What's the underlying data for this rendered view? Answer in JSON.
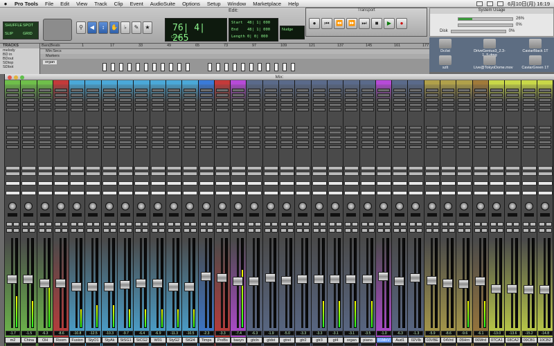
{
  "menubar": {
    "app": "Pro Tools",
    "items": [
      "File",
      "Edit",
      "View",
      "Track",
      "Clip",
      "Event",
      "AudioSuite",
      "Options",
      "Setup",
      "Window",
      "Marketplace",
      "Help"
    ],
    "clock": "6月10日(月)  16:19"
  },
  "edit": {
    "title": "Edit: ",
    "mode_labels": [
      "SHUFFLE",
      "SPOT",
      "SLIP",
      "GRID"
    ],
    "counter_main": "76| 4| 265",
    "counter_label": "Cursor",
    "selection": [
      {
        "label": "Start",
        "value": "48| 1| 000"
      },
      {
        "label": "End",
        "value": "48| 1| 000"
      },
      {
        "label": "Length",
        "value": "0| 0| 000"
      }
    ],
    "nudge_label": "Nudge"
  },
  "transport": {
    "title": "Transport"
  },
  "sysusage": {
    "title": "System Usage",
    "rows": [
      {
        "label": "",
        "value": "26%",
        "fill": 0.26
      },
      {
        "label": "",
        "value": "0%",
        "fill": 0.0
      },
      {
        "label": "Disk",
        "value": "0%",
        "fill": 0.0
      }
    ]
  },
  "desktop": [
    "Dc/ist",
    "DriveGenius3_2.3-1_5.dmg",
    "CaviarBlack 1T",
    "szlt",
    "Live@TokyoDome.mov",
    "CaviarGreen 1T"
  ],
  "tracks": {
    "header": "TRACKS",
    "names": [
      "melody",
      "BD in",
      "BDout",
      "SDtop",
      "SDbot"
    ],
    "ruler_label": "Bars|Beats",
    "ruler_marks": [
      "1",
      "17",
      "33",
      "49",
      "65",
      "73",
      "97",
      "109",
      "121",
      "137",
      "145",
      "161",
      "177"
    ],
    "min_secs": "Min:Secs",
    "markers": "Markers",
    "clip_name": "organ"
  },
  "mix": {
    "title": "Mix: ",
    "strips": [
      {
        "name": "m2",
        "color": "#6fbf4a",
        "vol": "-1.7",
        "foot": "3166",
        "level": 0.35,
        "fader": 0.55
      },
      {
        "name": "China",
        "color": "#6fbf4a",
        "vol": "-1.5",
        "foot": "3166",
        "level": 0.3,
        "fader": 0.55
      },
      {
        "name": "OH",
        "color": "#6fbf4a",
        "vol": "-6.3",
        "foot": "3166",
        "level": 0.55,
        "fader": 0.5
      },
      {
        "name": "Room",
        "color": "#c43a3a",
        "vol": "-8.6",
        "foot": "3169",
        "level": 0.0,
        "fader": 0.5
      },
      {
        "name": "Fusion",
        "color": "#4aa8d8",
        "vol": "-10.8",
        "foot": "3166",
        "level": 0.2,
        "fader": 0.45
      },
      {
        "name": "StyO1",
        "color": "#4aa8d8",
        "vol": "-12.5",
        "foot": "3166",
        "level": 0.25,
        "fader": 0.45
      },
      {
        "name": "StyAk",
        "color": "#4aa8d8",
        "vol": "-10.3",
        "foot": "3166",
        "level": 0.25,
        "fader": 0.45
      },
      {
        "name": "StSG1",
        "color": "#4aa8d8",
        "vol": "-9.7",
        "foot": "3166",
        "level": 0.2,
        "fader": 0.48
      },
      {
        "name": "StCG2",
        "color": "#4aa8d8",
        "vol": "-6.4",
        "foot": "3166",
        "level": 0.2,
        "fader": 0.5
      },
      {
        "name": "W01",
        "color": "#4aa8d8",
        "vol": "-6.9",
        "foot": "3166",
        "level": 0.2,
        "fader": 0.5
      },
      {
        "name": "StyG2",
        "color": "#4aa8d8",
        "vol": "-11.3",
        "foot": "3166",
        "level": 0.2,
        "fader": 0.45
      },
      {
        "name": "StGl4",
        "color": "#4aa8d8",
        "vol": "-10.5",
        "foot": "3166",
        "level": 0.2,
        "fader": 0.45
      },
      {
        "name": "Timps",
        "color": "#3a7ad8",
        "vol": "-2.3",
        "foot": "3166",
        "level": 0.0,
        "fader": 0.58
      },
      {
        "name": "ProBs",
        "color": "#c43a3a",
        "vol": "-3.3",
        "foot": "3166",
        "level": 0.0,
        "fader": 0.56
      },
      {
        "name": "basyn",
        "color": "#b64ad8",
        "vol": "-7.4",
        "foot": "3166",
        "level": 0.65,
        "fader": 0.52
      },
      {
        "name": "gtcln",
        "color": "#5a6a8a",
        "vol": "-6.3",
        "foot": "3166",
        "level": 0.0,
        "fader": 0.52
      },
      {
        "name": "gtdst",
        "color": "#5a6a8a",
        "vol": "-1.9",
        "foot": "3166",
        "level": 0.0,
        "fader": 0.56
      },
      {
        "name": "gtrel",
        "color": "#5a6a8a",
        "vol": "-5.0",
        "foot": "3166",
        "level": 0.0,
        "fader": 0.53
      },
      {
        "name": "gtr2",
        "color": "#5a6a8a",
        "vol": "-3.3",
        "foot": "3166",
        "level": 0.0,
        "fader": 0.55
      },
      {
        "name": "gtr3",
        "color": "#5a6a8a",
        "vol": "-3.3",
        "foot": "3166",
        "level": 0.3,
        "fader": 0.55
      },
      {
        "name": "gt4",
        "color": "#5a6a8a",
        "vol": "-3.1",
        "foot": "3166",
        "level": 0.3,
        "fader": 0.55
      },
      {
        "name": "organ",
        "color": "#5a6a8a",
        "vol": "-3.1",
        "foot": "3166",
        "level": 0.3,
        "fader": 0.55
      },
      {
        "name": "piano",
        "color": "#5a6a8a",
        "vol": "-3.5",
        "foot": "3166",
        "level": 0.3,
        "fader": 0.55
      },
      {
        "name": "01MnV",
        "color": "#b64ad8",
        "vol": "-1.0",
        "foot": "3166",
        "level": 0.0,
        "fader": 0.58,
        "hi": true
      },
      {
        "name": "Aud1",
        "color": "#5a6a8a",
        "vol": "-6.3",
        "foot": "3067",
        "level": 0.0,
        "fader": 0.52
      },
      {
        "name": "02VIb",
        "color": "#5a6a8a",
        "vol": "-1.3",
        "foot": "3166",
        "level": 0.0,
        "fader": 0.56
      },
      {
        "name": "03VBE",
        "color": "#b0a04a",
        "vol": "-5.9",
        "foot": "3166",
        "level": 0.0,
        "fader": 0.53
      },
      {
        "name": "04Vrd",
        "color": "#b0a04a",
        "vol": "-8.6",
        "foot": "3166",
        "level": 0.0,
        "fader": 0.5
      },
      {
        "name": "05Hrn",
        "color": "#b0a04a",
        "vol": "-9.6",
        "foot": "3166",
        "level": 0.3,
        "fader": 0.49
      },
      {
        "name": "06Wrd",
        "color": "#a07a3a",
        "vol": "-6.1",
        "foot": "3166",
        "level": 0.3,
        "fader": 0.52
      },
      {
        "name": "07CA1",
        "color": "#c8d848",
        "vol": "-13.0",
        "foot": "3166",
        "level": 0.0,
        "fader": 0.43
      },
      {
        "name": "08CA2",
        "color": "#c8d848",
        "vol": "-13.6",
        "foot": "3166",
        "level": 0.0,
        "fader": 0.43
      },
      {
        "name": "09CB1",
        "color": "#c8d848",
        "vol": "-15.2",
        "foot": "3166",
        "level": 0.0,
        "fader": 0.42
      },
      {
        "name": "10CB2",
        "color": "#c8d848",
        "vol": "-14.8",
        "foot": "3166",
        "level": 0.0,
        "fader": 0.42
      }
    ]
  }
}
